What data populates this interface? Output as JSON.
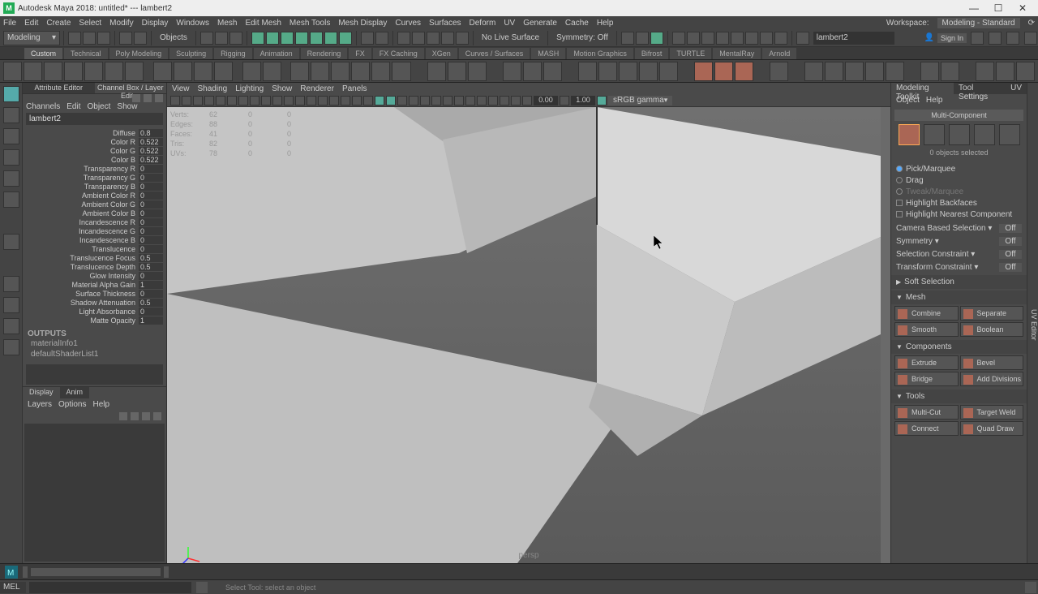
{
  "window": {
    "title": "Autodesk Maya 2018: untitled*  ---  lambert2"
  },
  "menubar": {
    "items": [
      "File",
      "Edit",
      "Create",
      "Select",
      "Modify",
      "Display",
      "Windows",
      "Mesh",
      "Edit Mesh",
      "Mesh Tools",
      "Mesh Display",
      "Curves",
      "Surfaces",
      "Deform",
      "UV",
      "Generate",
      "Cache",
      "Help"
    ],
    "workspace_label": "Workspace:",
    "workspace_value": "Modeling - Standard"
  },
  "top": {
    "mode": "Modeling",
    "objects": "Objects",
    "nosurf": "No Live Surface",
    "symmetry": "Symmetry: Off",
    "textfield": "lambert2",
    "signin": "Sign In"
  },
  "shelftabs": [
    "Custom",
    "Technical",
    "Poly Modeling",
    "Sculpting",
    "Rigging",
    "Animation",
    "Rendering",
    "FX",
    "FX Caching",
    "XGen",
    "Curves / Surfaces",
    "MASH",
    "Motion Graphics",
    "Bifrost",
    "TURTLE",
    "MentalRay",
    "Arnold"
  ],
  "channelbox": {
    "tabs": {
      "left": "Attribute Editor",
      "right": "Channel Box / Layer Editor"
    },
    "menus": [
      "Channels",
      "Edit",
      "Object",
      "Show"
    ],
    "name": "lambert2",
    "attrs": [
      {
        "n": "Diffuse",
        "v": "0.8"
      },
      {
        "n": "Color R",
        "v": "0.522"
      },
      {
        "n": "Color G",
        "v": "0.522"
      },
      {
        "n": "Color B",
        "v": "0.522"
      },
      {
        "n": "Transparency R",
        "v": "0"
      },
      {
        "n": "Transparency G",
        "v": "0"
      },
      {
        "n": "Transparency B",
        "v": "0"
      },
      {
        "n": "Ambient Color R",
        "v": "0"
      },
      {
        "n": "Ambient Color G",
        "v": "0"
      },
      {
        "n": "Ambient Color B",
        "v": "0"
      },
      {
        "n": "Incandescence R",
        "v": "0"
      },
      {
        "n": "Incandescence G",
        "v": "0"
      },
      {
        "n": "Incandescence B",
        "v": "0"
      },
      {
        "n": "Translucence",
        "v": "0"
      },
      {
        "n": "Translucence Focus",
        "v": "0.5"
      },
      {
        "n": "Translucence Depth",
        "v": "0.5"
      },
      {
        "n": "Glow Intensity",
        "v": "0"
      },
      {
        "n": "Material Alpha Gain",
        "v": "1"
      },
      {
        "n": "Surface Thickness",
        "v": "0"
      },
      {
        "n": "Shadow Attenuation",
        "v": "0.5"
      },
      {
        "n": "Light Absorbance",
        "v": "0"
      },
      {
        "n": "Matte Opacity",
        "v": "1"
      }
    ],
    "outputs": {
      "title": "OUTPUTS",
      "items": [
        "materialInfo1",
        "defaultShaderList1"
      ]
    },
    "layer": {
      "tabs": [
        "Display",
        "Anim"
      ],
      "menus": [
        "Layers",
        "Options",
        "Help"
      ]
    }
  },
  "viewport": {
    "menus": [
      "View",
      "Shading",
      "Lighting",
      "Show",
      "Renderer",
      "Panels"
    ],
    "num1": "0.00",
    "num2": "1.00",
    "gamma": "sRGB gamma",
    "hud": {
      "rows": [
        {
          "a": "Verts:",
          "b": "62",
          "c": "0",
          "d": "0"
        },
        {
          "a": "Edges:",
          "b": "88",
          "c": "0",
          "d": "0"
        },
        {
          "a": "Faces:",
          "b": "41",
          "c": "0",
          "d": "0"
        },
        {
          "a": "Tris:",
          "b": "82",
          "c": "0",
          "d": "0"
        },
        {
          "a": "UVs:",
          "b": "78",
          "c": "0",
          "d": "0"
        }
      ]
    },
    "label": "persp"
  },
  "toolkit": {
    "tab1": "Modeling Toolkit",
    "tab2": "Tool Settings",
    "tab3": "UV",
    "menus": [
      "Object",
      "Help"
    ],
    "multi": "Multi-Component",
    "selected": "0 objects selected",
    "picks": [
      {
        "radio": true,
        "on": true,
        "label": "Pick/Marquee"
      },
      {
        "radio": true,
        "on": false,
        "label": "Drag"
      },
      {
        "radio": true,
        "on": false,
        "label": "Tweak/Marquee",
        "dim": true
      },
      {
        "radio": false,
        "on": false,
        "label": "Highlight Backfaces"
      },
      {
        "radio": false,
        "on": false,
        "label": "Highlight Nearest Component"
      }
    ],
    "opts": [
      {
        "l": "Camera Based Selection",
        "v": "Off"
      },
      {
        "l": "Symmetry",
        "v": "Off"
      },
      {
        "l": "Selection Constraint",
        "v": "Off"
      },
      {
        "l": "Transform Constraint",
        "v": "Off"
      }
    ],
    "soft": "Soft Selection",
    "sections": {
      "mesh": {
        "t": "Mesh",
        "b": [
          "Combine",
          "Separate",
          "Smooth",
          "Boolean"
        ]
      },
      "comp": {
        "t": "Components",
        "b": [
          "Extrude",
          "Bevel",
          "Bridge",
          "Add Divisions"
        ]
      },
      "tools": {
        "t": "Tools",
        "b": [
          "Multi-Cut",
          "Target Weld",
          "Connect",
          "Quad Draw"
        ]
      }
    }
  },
  "uvtab": "UV Editor",
  "cmd": {
    "mel": "MEL",
    "status": "Select Tool: select an object"
  }
}
